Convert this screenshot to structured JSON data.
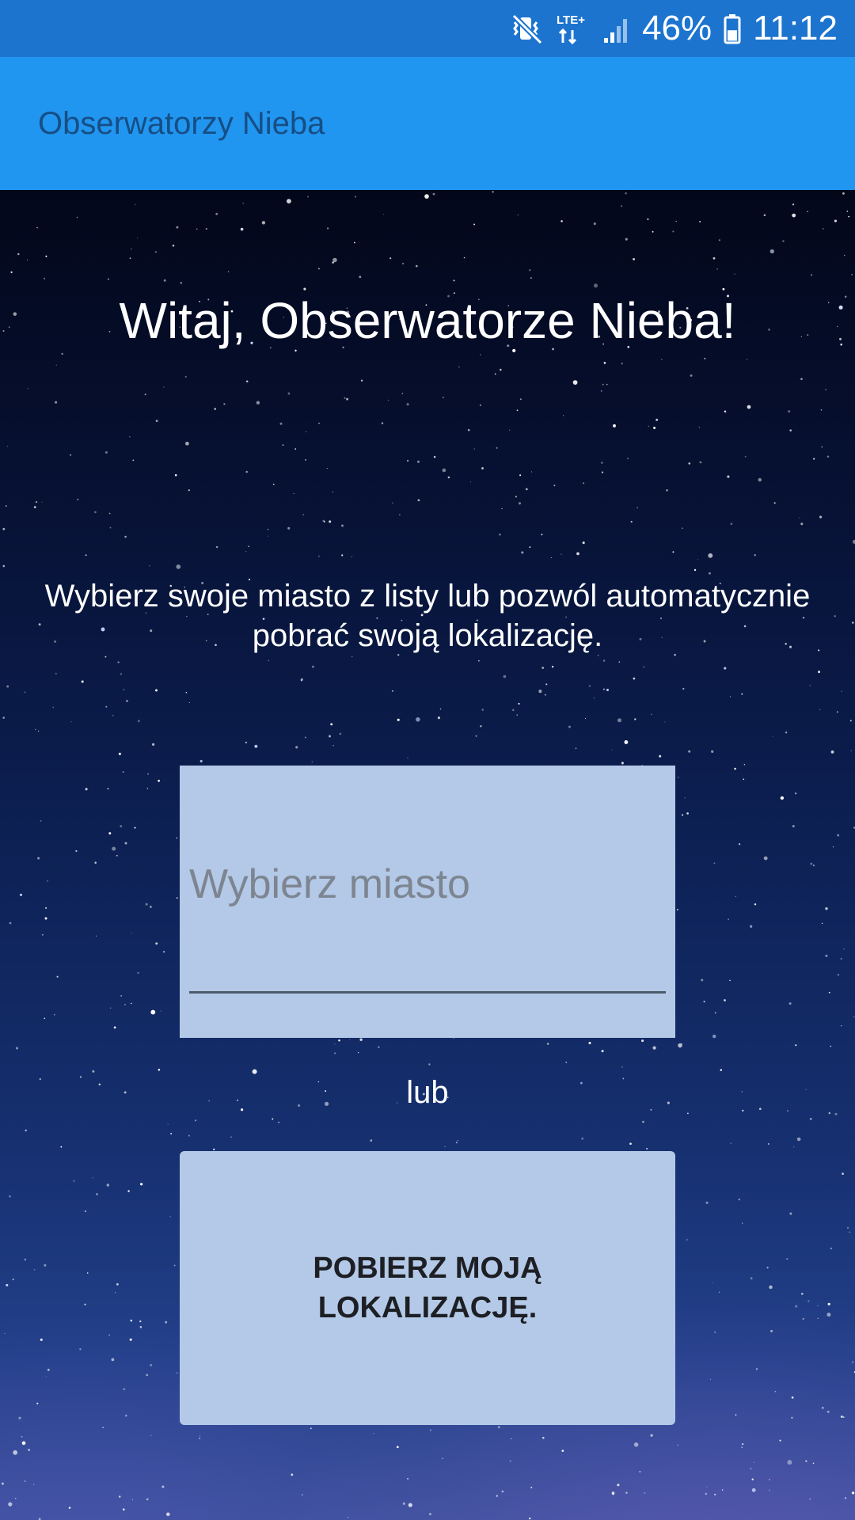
{
  "status_bar": {
    "icons": [
      "vibrate-mute-icon",
      "lte-data-icon",
      "signal-icon",
      "battery-icon"
    ],
    "network_label": "LTE+",
    "battery_percent": "46%",
    "battery_level": 0.46,
    "time": "11:12"
  },
  "app_bar": {
    "title": "Obserwatorzy Nieba"
  },
  "main": {
    "welcome": "Witaj, Obserwatorze Nieba!",
    "instruction": "Wybierz swoje miasto z listy lub pozwól automatycznie pobrać swoją lokalizację.",
    "city_input": {
      "placeholder": "Wybierz miasto",
      "value": ""
    },
    "or_label": "lub",
    "location_button_label": "POBIERZ MOJĄ LOKALIZACJĘ."
  },
  "colors": {
    "status_bar": "#1c74cf",
    "app_bar": "#2196f0",
    "app_title": "#164e85",
    "panel": "#b3c9e7"
  }
}
